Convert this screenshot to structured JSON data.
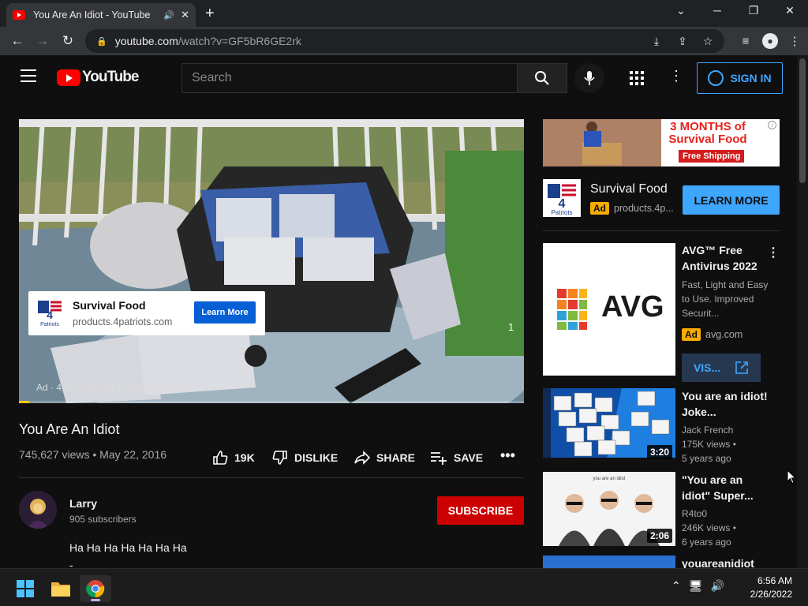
{
  "browser": {
    "tab_title": "You Are An Idiot - YouTube",
    "tab_close": "✕",
    "new_tab": "+",
    "url_host": "youtube.com",
    "url_path": "/watch?v=GF5bR6GE2rk",
    "win_min": "─",
    "win_restore": "❐",
    "win_close": "✕",
    "chevron": "⌄"
  },
  "youtube": {
    "logo_text": "YouTube",
    "search_placeholder": "Search",
    "signin_label": "SIGN IN",
    "more": "⋮"
  },
  "video": {
    "title": "You Are An Idiot",
    "meta": "745,627 views • May 22, 2016",
    "likes": "19K",
    "dislike": "DISLIKE",
    "share": "SHARE",
    "save": "SAVE",
    "more": "•••",
    "ad_card_name": "Survival Food",
    "ad_card_url": "products.4patriots.com",
    "ad_card_button": "Learn More",
    "ad_info": "Ad · 4:08  ⓘ   products.4patriots.com ⧉",
    "ad_count": "1",
    "ad_progress": 0.02
  },
  "channel": {
    "name": "Larry",
    "subs": "905 subscribers",
    "subscribe": "SUBSCRIBE",
    "description": "Ha Ha Ha Ha Ha Ha Ha",
    "description2": "-"
  },
  "sidebar": {
    "banner_text": "3 MONTHS of Survival Food",
    "banner_ship": "Free Shipping",
    "promo_title": "Survival Food",
    "promo_ad": "Ad",
    "promo_url": "products.4p...",
    "promo_button": "LEARN MORE",
    "avg": {
      "title": "AVG™ Free Antivirus 2022",
      "desc": "Fast, Light and Easy to Use. Improved Securit...",
      "ad": "Ad",
      "url": "avg.com",
      "visit": "VIS...",
      "logo": "AVG"
    },
    "videos": [
      {
        "title": "You are an idiot! Joke...",
        "channel": "Jack French",
        "views": "175K views •",
        "age": "5 years ago",
        "duration": "3:20"
      },
      {
        "title": "\"You are an idiot\" Super...",
        "channel": "R4to0",
        "views": "246K views •",
        "age": "6 years ago",
        "duration": "2:06",
        "thumb_caption": "you are an idiot"
      },
      {
        "title": "youareanidiot"
      }
    ]
  },
  "taskbar": {
    "time": "6:56 AM",
    "date": "2/26/2022"
  }
}
